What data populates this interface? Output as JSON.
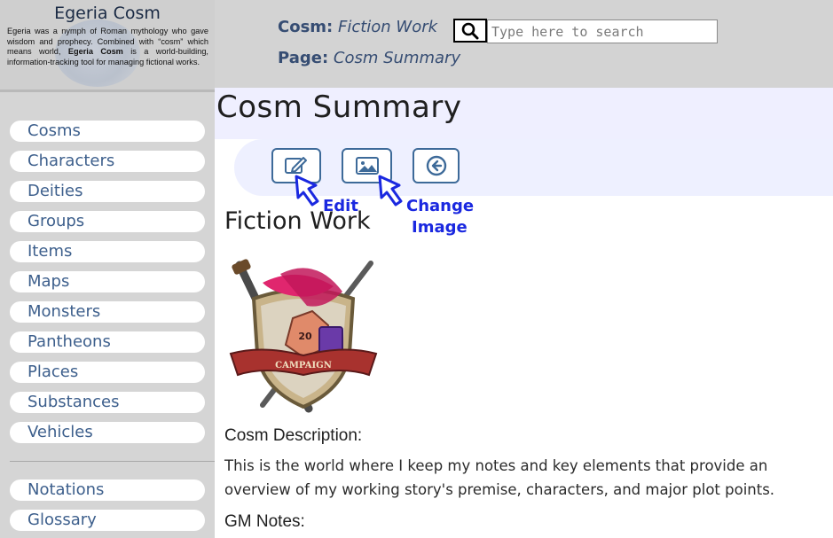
{
  "sidebar": {
    "brand_title": "Egeria Cosm",
    "brand_desc_1": "Egeria was a nymph of Roman mythology who gave wisdom and prophecy. Combined with “cosm” which means world, ",
    "brand_desc_bold": "Egeria Cosm",
    "brand_desc_2": " is a world-building, information-tracking tool for managing fictional works.",
    "items": [
      {
        "label": "Cosms"
      },
      {
        "label": "Characters"
      },
      {
        "label": "Deities"
      },
      {
        "label": "Groups"
      },
      {
        "label": "Items"
      },
      {
        "label": "Maps"
      },
      {
        "label": "Monsters"
      },
      {
        "label": "Pantheons"
      },
      {
        "label": "Places"
      },
      {
        "label": "Substances"
      },
      {
        "label": "Vehicles"
      }
    ],
    "items2": [
      {
        "label": "Notations"
      },
      {
        "label": "Glossary"
      }
    ]
  },
  "header": {
    "cosm_key": "Cosm:",
    "cosm_value": "Fiction Work",
    "page_key": "Page:",
    "page_value": "Cosm Summary",
    "search_placeholder": "Type here to search"
  },
  "main": {
    "page_title": "Cosm Summary",
    "annot_edit": "Edit",
    "annot_change_1": "Change",
    "annot_change_2": "Image",
    "work_title": "Fiction Work",
    "image_banner": "CAMPAIGN",
    "dice_number": "20",
    "desc_label": "Cosm Description:",
    "description": "This is the world where I keep my notes and key elements that provide an overview of my working story's premise, characters, and major plot points.",
    "gm_label": "GM Notes:"
  },
  "colors": {
    "sidebar_bg": "#d5d5d5",
    "nav_text": "#3d5f8c",
    "header_text": "#364d73",
    "annotation": "#1a28e0",
    "toolbar_bg": "#eef0ff"
  }
}
